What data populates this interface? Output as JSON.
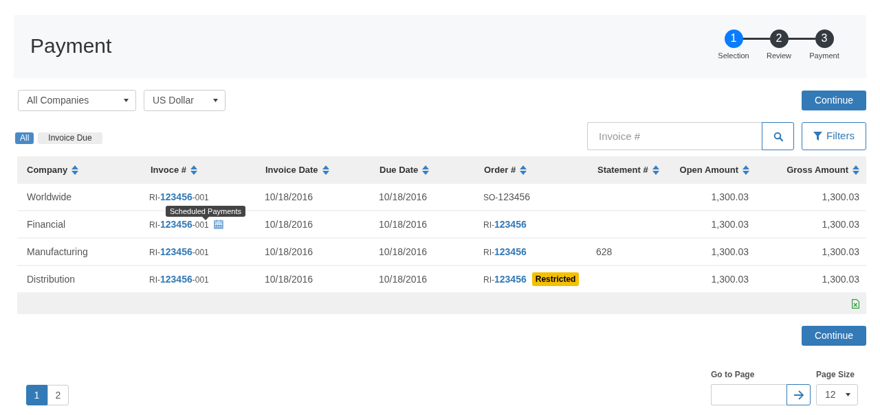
{
  "header": {
    "title": "Payment"
  },
  "steps": [
    {
      "number": "1",
      "label": "Selection",
      "selected": true
    },
    {
      "number": "2",
      "label": "Review",
      "selected": false
    },
    {
      "number": "3",
      "label": "Payment",
      "selected": false
    }
  ],
  "filters": {
    "company_select": "All Companies",
    "currency_select": "US Dollar",
    "continue_button": "Continue"
  },
  "tags": [
    {
      "label": "All",
      "selected": true
    },
    {
      "label": "Invoice Due",
      "selected": false
    }
  ],
  "search": {
    "placeholder": "Invoice #",
    "filters_button": "Filters"
  },
  "table": {
    "columns": [
      {
        "label": "Company",
        "kind": "text"
      },
      {
        "label": "Invoce #",
        "kind": "text"
      },
      {
        "label": "Invoice Date",
        "kind": "text"
      },
      {
        "label": "Due Date",
        "kind": "text"
      },
      {
        "label": "Order #",
        "kind": "text"
      },
      {
        "label": "Statement #",
        "kind": "text"
      },
      {
        "label": "Open Amount",
        "kind": "amount"
      },
      {
        "label": "Gross Amount",
        "kind": "amount"
      }
    ],
    "rows": [
      {
        "company": "Worldwide",
        "invoice": {
          "prefix": "RI-",
          "number": "123456",
          "suffix": "-001",
          "scheduled": false
        },
        "invoice_date": "10/18/2016",
        "due_date": "10/18/2016",
        "order": {
          "prefix": "SO-",
          "number": "123456",
          "linked": false
        },
        "open_amount": "1,300.03",
        "gross_amount": "1,300.03"
      },
      {
        "company": "Financial",
        "invoice": {
          "prefix": "RI-",
          "number": "123456",
          "suffix": "-001",
          "scheduled": true
        },
        "invoice_date": "10/18/2016",
        "due_date": "10/18/2016",
        "order": {
          "prefix": "RI-",
          "number": "123456",
          "linked": true
        },
        "open_amount": "1,300.03",
        "gross_amount": "1,300.03"
      },
      {
        "company": "Manufacturing",
        "invoice": {
          "prefix": "RI-",
          "number": "123456",
          "suffix": "-001",
          "scheduled": false
        },
        "invoice_date": "10/18/2016",
        "due_date": "10/18/2016",
        "order": {
          "prefix": "RI-",
          "number": "123456",
          "linked": true
        },
        "statement": "628",
        "open_amount": "1,300.03",
        "gross_amount": "1,300.03"
      },
      {
        "company": "Distribution",
        "invoice": {
          "prefix": "RI-",
          "number": "123456",
          "suffix": "-001",
          "scheduled": false
        },
        "invoice_date": "10/18/2016",
        "due_date": "10/18/2016",
        "order": {
          "prefix": "RI-",
          "number": "123456",
          "linked": true,
          "badge": "Restricted"
        },
        "open_amount": "1,300.03",
        "gross_amount": "1,300.03"
      }
    ],
    "tooltip": "Scheduled Payments"
  },
  "footer": {
    "continue_button": "Continue",
    "pages": [
      {
        "label": "1",
        "selected": true
      },
      {
        "label": "2",
        "selected": false
      }
    ],
    "go_to_page_label": "Go to Page",
    "page_size_label": "Page Size",
    "page_size": "12"
  }
}
